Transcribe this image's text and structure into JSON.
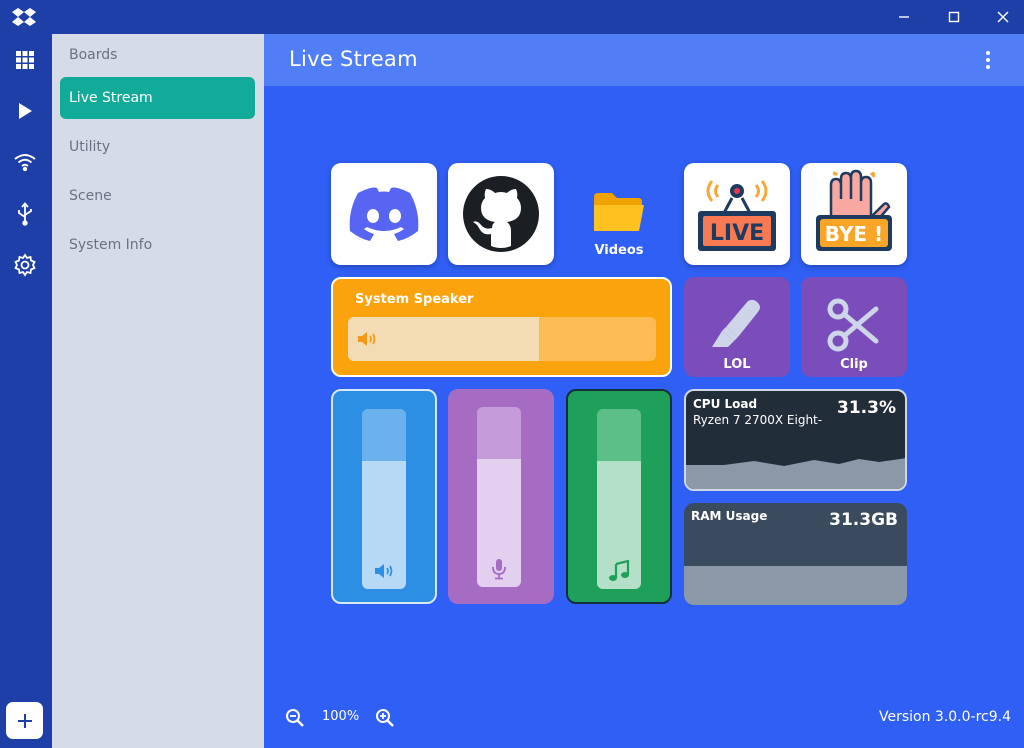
{
  "window": {
    "title": "",
    "controls": [
      "minimize",
      "maximize",
      "close"
    ]
  },
  "rail": {
    "items": [
      "grid-icon",
      "play-icon",
      "wifi-icon",
      "usb-icon",
      "gear-icon"
    ],
    "add_label": "+"
  },
  "boards": {
    "items": [
      {
        "label": "Boards",
        "active": false
      },
      {
        "label": "Live Stream",
        "active": true
      },
      {
        "label": "Utility",
        "active": false
      },
      {
        "label": "Scene",
        "active": false
      },
      {
        "label": "System Info",
        "active": false
      }
    ]
  },
  "header": {
    "title": "Live Stream"
  },
  "tiles": {
    "discord": {
      "icon": "discord-icon",
      "color": "#5865f2"
    },
    "github": {
      "icon": "github-icon",
      "color": "#1b1f23"
    },
    "videos": {
      "label": "Videos",
      "icon": "folder-icon"
    },
    "live": {
      "icon": "live-sign-icon",
      "text": "LIVE"
    },
    "bye": {
      "icon": "bye-hand-icon",
      "text": "BYE !"
    },
    "speaker": {
      "label": "System Speaker",
      "level": 0.62,
      "color": "#fba30d"
    },
    "lol": {
      "label": "LOL",
      "icon": "highlighter-icon"
    },
    "clip": {
      "label": "Clip",
      "icon": "scissors-icon"
    },
    "sliders": [
      {
        "icon": "speaker-icon",
        "level": 0.71,
        "color": "#2d8fe3",
        "selected": true
      },
      {
        "icon": "microphone-icon",
        "level": 0.71,
        "color": "#a66cc4",
        "selected": false
      },
      {
        "icon": "music-note-icon",
        "level": 0.71,
        "color": "#1fa05a",
        "selected": false
      }
    ],
    "cpu": {
      "name": "CPU Load",
      "sub": "Ryzen 7 2700X Eight-",
      "value": "31.3%"
    },
    "ram": {
      "name": "RAM Usage",
      "value": "31.3GB"
    }
  },
  "footer": {
    "zoom": "100%",
    "version": "Version 3.0.0-rc9.4"
  },
  "colors": {
    "canvas": "#2f5ff5",
    "sidebar": "#1e3fa8",
    "active_board": "#12ab9a"
  }
}
